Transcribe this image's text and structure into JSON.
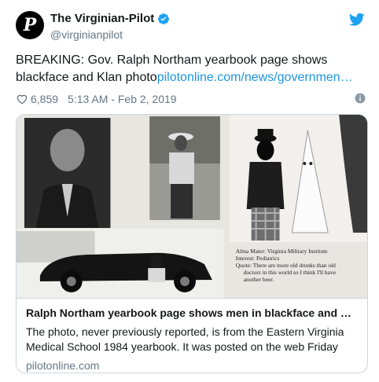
{
  "account": {
    "display_name": "The Virginian-Pilot",
    "handle": "@virginianpilot",
    "avatar_glyph": "P"
  },
  "tweet": {
    "text": "BREAKING: Gov. Ralph Northam yearbook page shows blackface and Klan photo",
    "link": "pilotonline.com/news/governmen…",
    "likes": "6,859",
    "timestamp": "5:13 AM - Feb 2, 2019"
  },
  "card": {
    "title": "Ralph Northam yearbook page shows men in blackface and K…",
    "description": "The photo, never previously reported, is from the Eastern Virginia Medical School 1984 yearbook. It was posted on the web Friday",
    "domain": "pilotonline.com",
    "image_caption": {
      "line1": "Alma Mater: Virginia Military Institute",
      "line2": "Interest: Pediatrics",
      "line3": "Quote: There are more old drunks than old",
      "line4": "doctors in this world so I think I'll have",
      "line5": "another beer."
    }
  },
  "colors": {
    "link": "#1b95e0",
    "verified": "#1da1f2",
    "muted": "#657786",
    "border": "#ccd6dd"
  },
  "icons": [
    "verified-badge-icon",
    "twitter-bird-icon",
    "heart-icon",
    "info-icon"
  ]
}
